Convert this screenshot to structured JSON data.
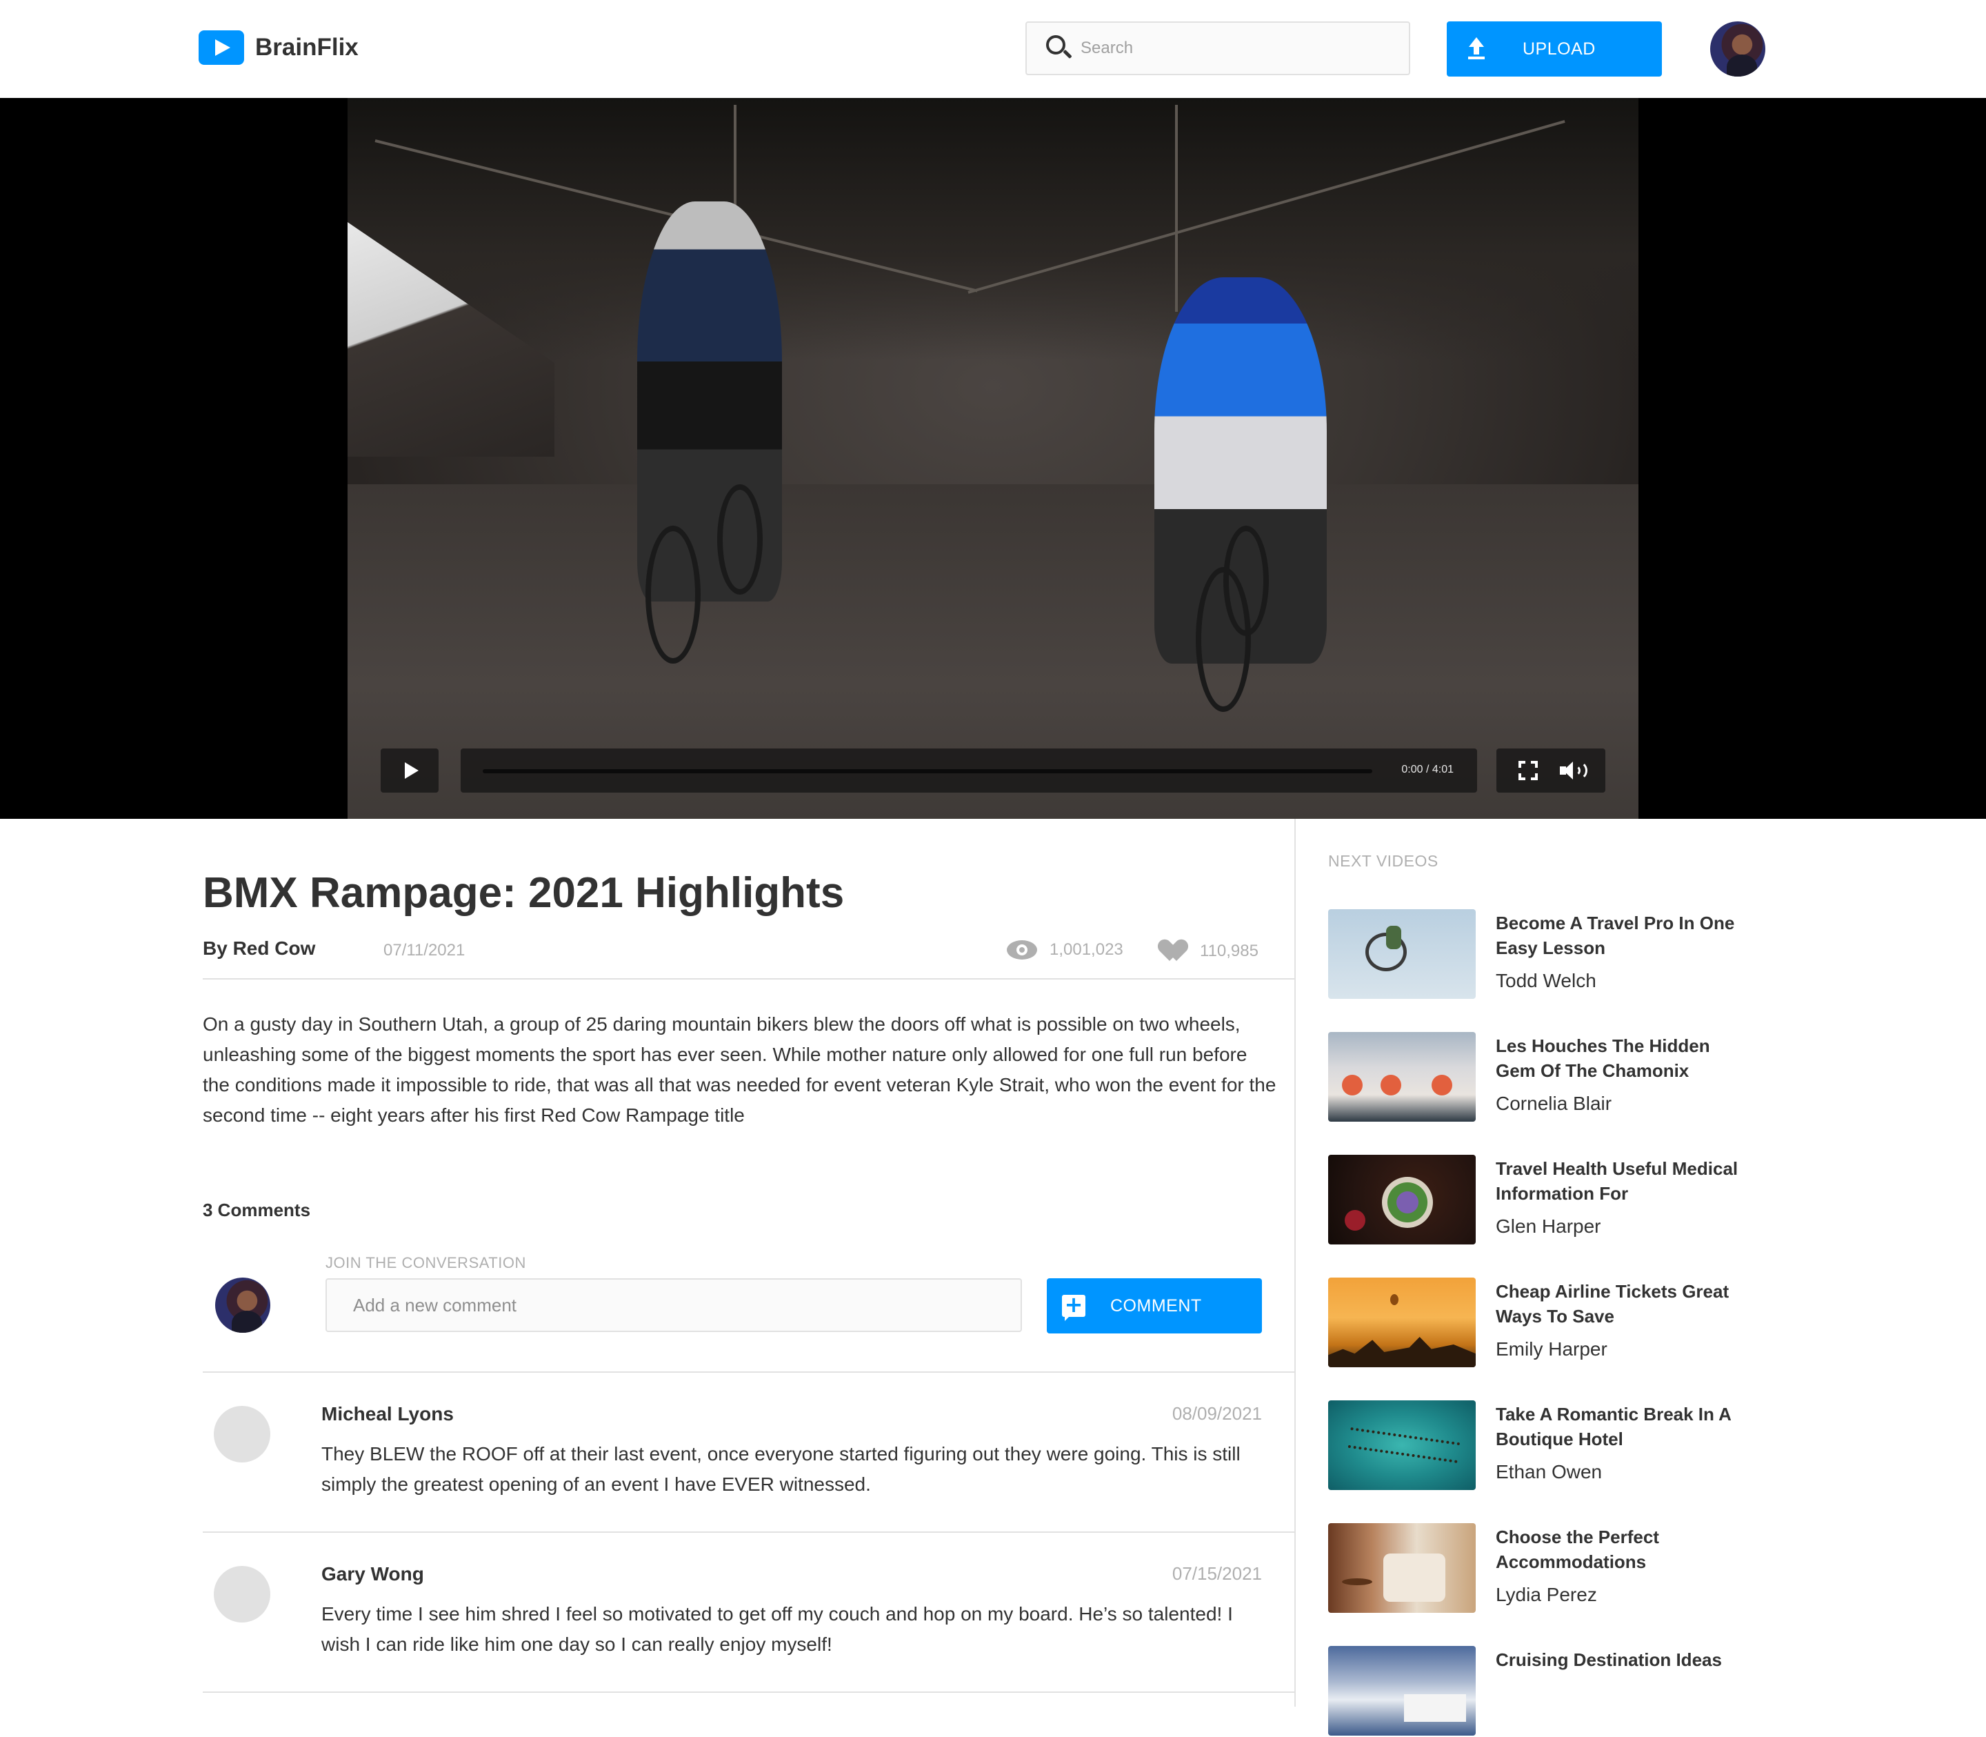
{
  "header": {
    "logo_text": "BrainFlix",
    "search_placeholder": "Search",
    "upload_label": "UPLOAD"
  },
  "video": {
    "time": "0:00 / 4:01",
    "progress": 0
  },
  "details": {
    "title": "BMX Rampage: 2021 Highlights",
    "byline": "By Red Cow",
    "date": "07/11/2021",
    "views": "1,001,023",
    "likes": "110,985",
    "description": "On a gusty day in Southern Utah, a group of 25 daring mountain bikers blew the doors off what is possible on two wheels, unleashing some of the biggest moments the sport has ever seen. While mother nature only allowed for one full run before the conditions made it impossible to ride, that was all that was needed for event veteran Kyle Strait, who won the event for the second time -- eight years after his first Red Cow Rampage title"
  },
  "comments": {
    "count_label": "3 Comments",
    "join_label": "JOIN THE CONVERSATION",
    "input_placeholder": "Add a new comment",
    "button_label": "COMMENT",
    "items": [
      {
        "name": "Micheal Lyons",
        "date": "08/09/2021",
        "text": "They BLEW the ROOF off at their last event, once everyone started figuring out they were going. This is still simply the greatest opening of an event I have EVER witnessed."
      },
      {
        "name": "Gary Wong",
        "date": "07/15/2021",
        "text": "Every time I see him shred I feel so motivated to get off my couch and hop on my board. He’s so talented! I wish I can ride like him one day so I can really enjoy myself!"
      }
    ]
  },
  "sidebar": {
    "label": "NEXT VIDEOS",
    "videos": [
      {
        "title": "Become A Travel Pro In One Easy Lesson",
        "channel": "Todd Welch"
      },
      {
        "title": "Les Houches The Hidden Gem Of The Chamonix",
        "channel": "Cornelia Blair"
      },
      {
        "title": "Travel Health Useful Medical Information For",
        "channel": "Glen Harper"
      },
      {
        "title": "Cheap Airline Tickets Great Ways To Save",
        "channel": "Emily Harper"
      },
      {
        "title": "Take A Romantic Break In A Boutique Hotel",
        "channel": "Ethan Owen"
      },
      {
        "title": "Choose the Perfect Accommodations",
        "channel": "Lydia Perez"
      },
      {
        "title": "Cruising Destination Ideas",
        "channel": ""
      }
    ]
  },
  "colors": {
    "accent": "#0095ff",
    "text": "#323232",
    "muted": "#afafaf",
    "border": "#e1e1e1"
  },
  "icons": [
    "logo-play-icon",
    "search-icon",
    "upload-icon",
    "play-icon",
    "fullscreen-icon",
    "volume-icon",
    "eye-icon",
    "heart-icon",
    "add-comment-icon"
  ]
}
